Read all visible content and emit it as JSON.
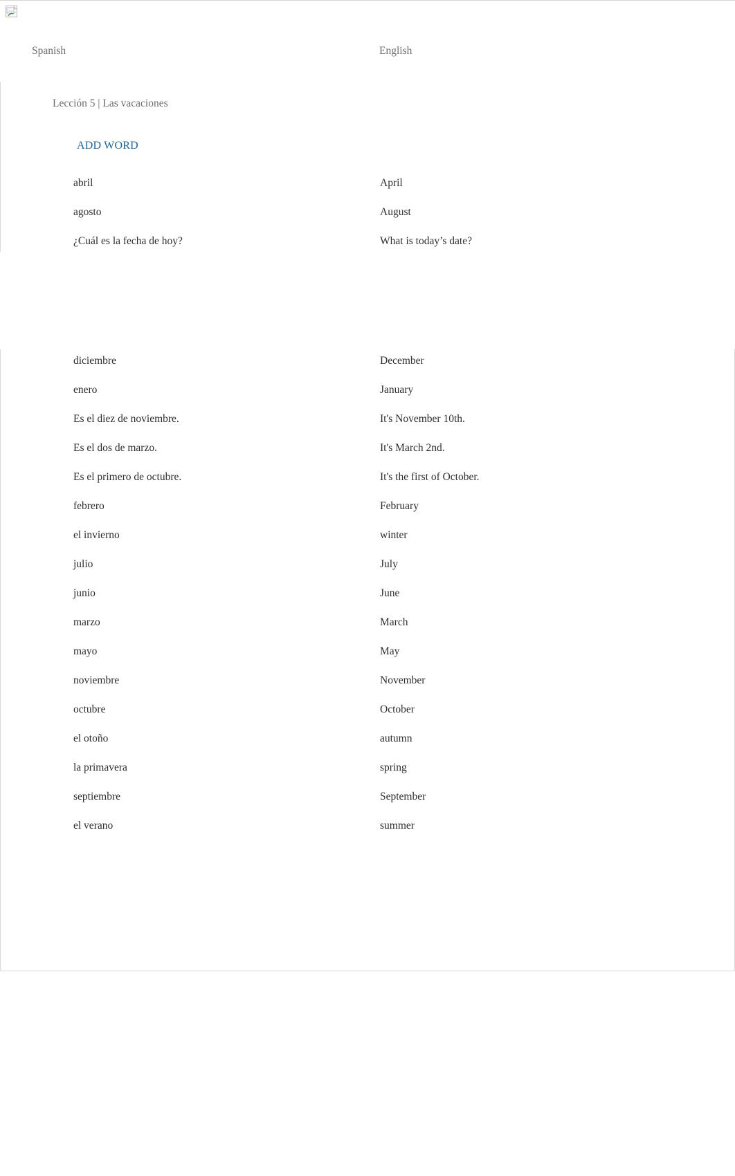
{
  "page": {
    "icon": "broken-image-icon",
    "accent_color": "#1667a4",
    "text_color": "#2e2e2e",
    "muted_color": "#6d6d6d",
    "border_color": "#d9d9d9"
  },
  "columns": {
    "left_header": "Spanish",
    "right_header": "English"
  },
  "lesson": {
    "title": "Lección 5 | Las vacaciones",
    "add_word_label": "ADD WORD"
  },
  "top_entries": [
    {
      "term": "abril",
      "meaning": "April"
    },
    {
      "term": "agosto",
      "meaning": "August"
    },
    {
      "term": "¿Cuál es la fecha de hoy?",
      "meaning": "What is today’s date?"
    }
  ],
  "bottom_entries": [
    {
      "term": "diciembre",
      "meaning": "December"
    },
    {
      "term": "enero",
      "meaning": "January"
    },
    {
      "term": "Es el diez de noviembre.",
      "meaning": "It's November 10th."
    },
    {
      "term": "Es el dos de marzo.",
      "meaning": "It's March 2nd."
    },
    {
      "term": "Es el primero de octubre.",
      "meaning": "It's the first of October."
    },
    {
      "term": "febrero",
      "meaning": "February"
    },
    {
      "term": "el invierno",
      "meaning": "winter"
    },
    {
      "term": "julio",
      "meaning": "July"
    },
    {
      "term": "junio",
      "meaning": "June"
    },
    {
      "term": "marzo",
      "meaning": "March"
    },
    {
      "term": "mayo",
      "meaning": "May"
    },
    {
      "term": "noviembre",
      "meaning": "November"
    },
    {
      "term": "octubre",
      "meaning": "October"
    },
    {
      "term": "el otoño",
      "meaning": "autumn"
    },
    {
      "term": "la primavera",
      "meaning": "spring"
    },
    {
      "term": "septiembre",
      "meaning": "September"
    },
    {
      "term": "el verano",
      "meaning": "summer"
    }
  ]
}
